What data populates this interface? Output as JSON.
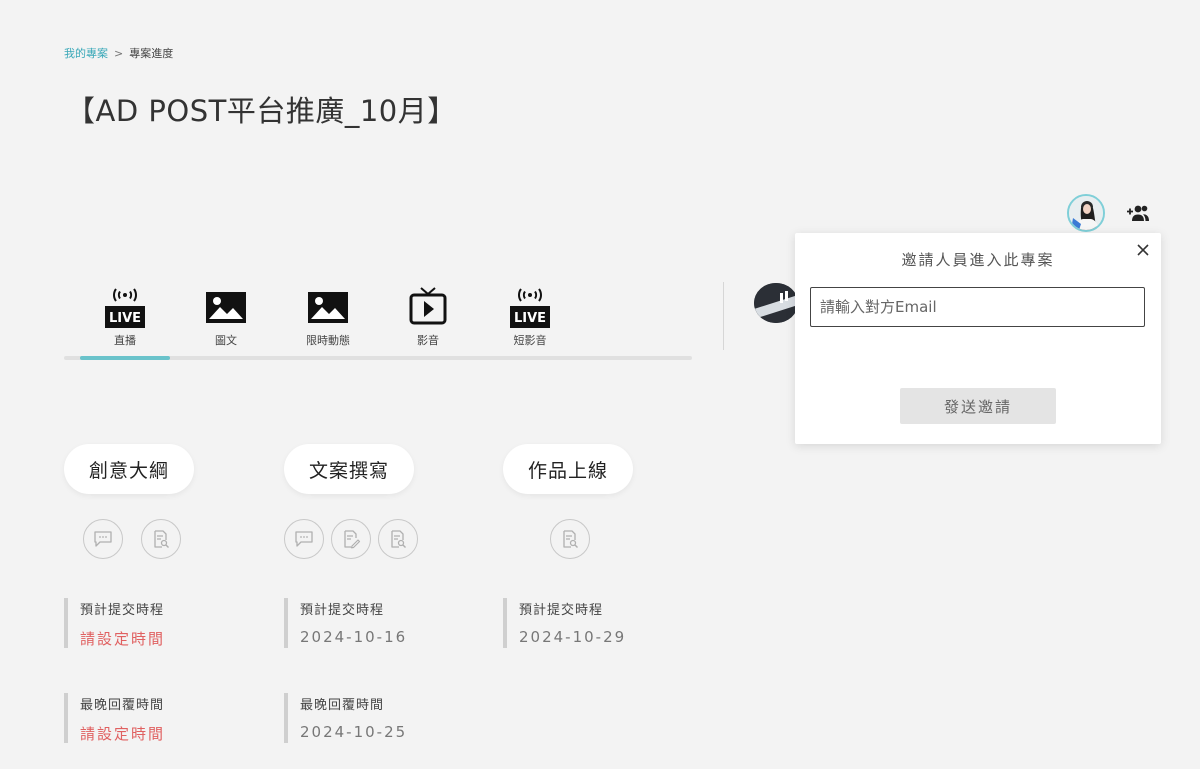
{
  "breadcrumb": {
    "parent": "我的專案",
    "separator": ">",
    "current": "專案進度"
  },
  "project": {
    "title": "【AD POST平台推廣_10月】"
  },
  "tabs": [
    {
      "label": "直播",
      "icon": "live-icon",
      "badge": "LIVE"
    },
    {
      "label": "圖文",
      "icon": "image-icon"
    },
    {
      "label": "限時動態",
      "icon": "image-icon"
    },
    {
      "label": "影音",
      "icon": "tv-play-icon"
    },
    {
      "label": "短影音",
      "icon": "live-icon",
      "badge": "LIVE"
    }
  ],
  "active_tab": 0,
  "invite_modal": {
    "title": "邀請人員進入此專案",
    "email_placeholder": "請輸入對方Email",
    "email_value": "",
    "send_label": "發送邀請"
  },
  "stages": [
    {
      "name": "創意大綱",
      "actions": [
        "comment-icon",
        "document-search-icon"
      ],
      "submit_label": "預計提交時程",
      "submit_value": "請設定時間",
      "submit_unset": true,
      "reply_label": "最晚回覆時間",
      "reply_value": "請設定時間",
      "reply_unset": true
    },
    {
      "name": "文案撰寫",
      "actions": [
        "comment-icon",
        "document-edit-icon",
        "document-search-icon"
      ],
      "submit_label": "預計提交時程",
      "submit_value": "2024-10-16",
      "submit_unset": false,
      "reply_label": "最晚回覆時間",
      "reply_value": "2024-10-25",
      "reply_unset": false
    },
    {
      "name": "作品上線",
      "actions": [
        "document-search-icon"
      ],
      "submit_label": "預計提交時程",
      "submit_value": "2024-10-29",
      "submit_unset": false
    }
  ],
  "colors": {
    "accent": "#6ac3cb",
    "link": "#3aa8b8",
    "warning": "#e06060"
  }
}
